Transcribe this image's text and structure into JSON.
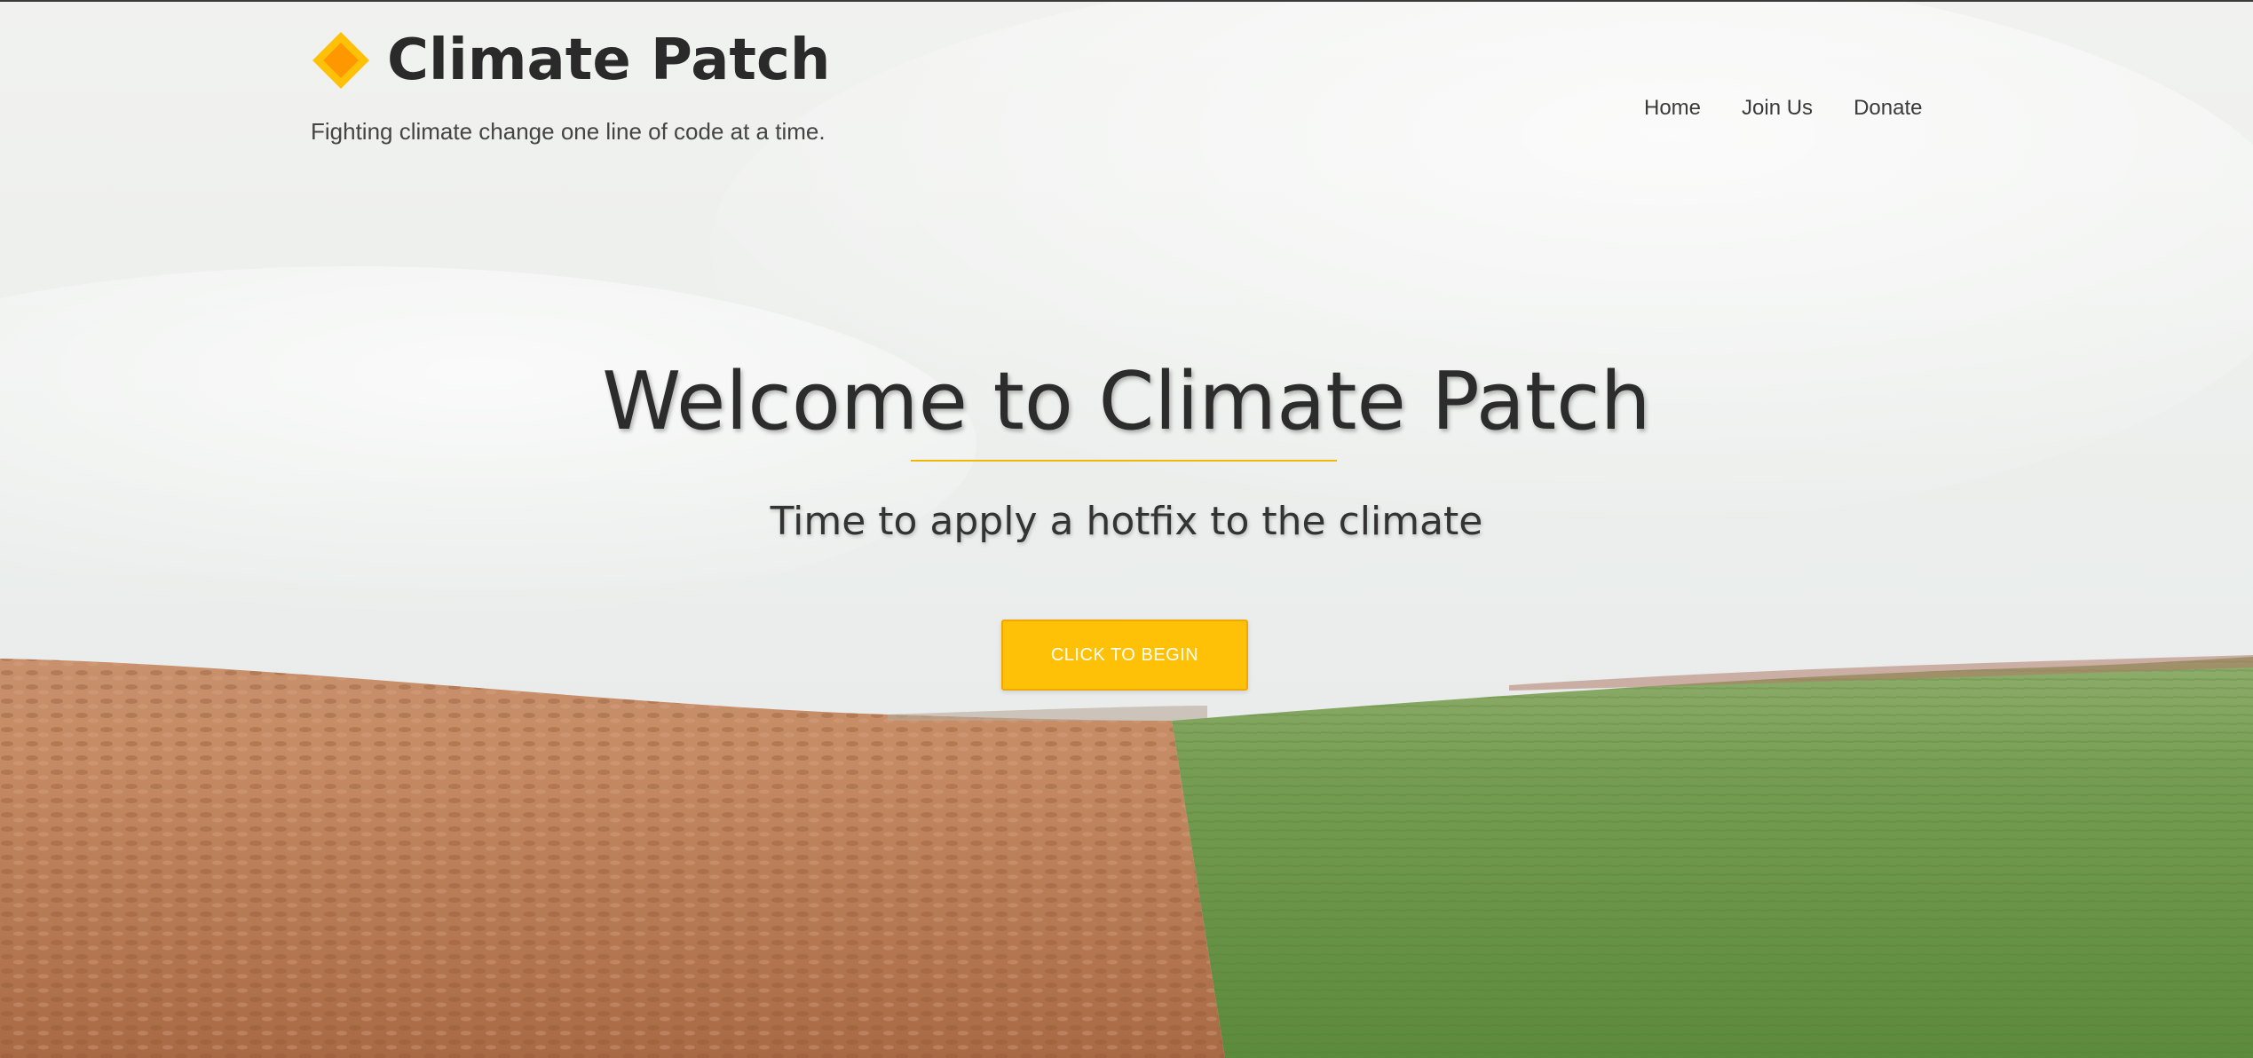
{
  "header": {
    "brand_title": "Climate Patch",
    "tagline": "Fighting climate change one line of code at a time.",
    "logo_icon": "diamond-logo-icon"
  },
  "nav": {
    "items": [
      {
        "label": "Home"
      },
      {
        "label": "Join Us"
      },
      {
        "label": "Donate"
      }
    ]
  },
  "hero": {
    "title": "Welcome to Climate Patch",
    "subtitle": "Time to apply a hotfix to the climate",
    "cta_label": "CLICK TO BEGIN",
    "background": "split-field-landscape"
  },
  "colors": {
    "accent": "#ffc107",
    "accent_border": "#f0a800",
    "logo_orange": "#ff9800",
    "text_dark": "#2c2c2c",
    "field_soil": "#b87a52",
    "field_grass": "#6b9a4a",
    "sky": "#eef0ee"
  }
}
